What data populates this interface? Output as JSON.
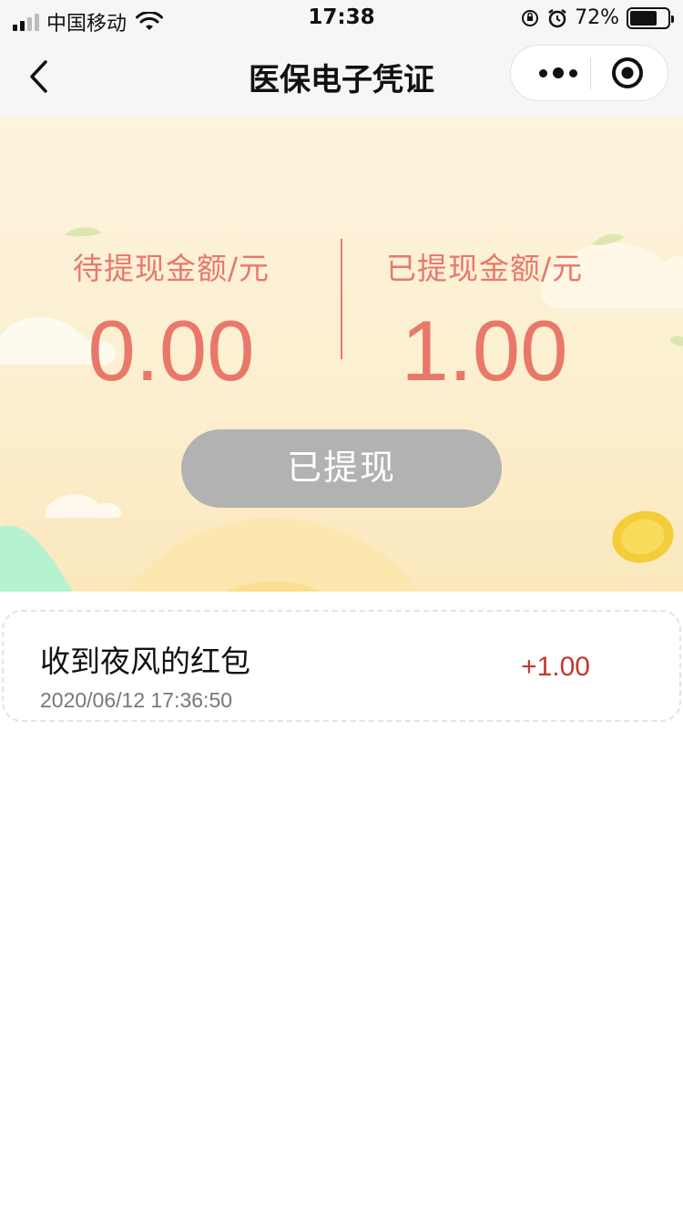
{
  "status_bar": {
    "carrier": "中国移动",
    "time": "17:38",
    "battery_percent": "72%",
    "battery_level": 0.72,
    "icons": [
      "signal-icon",
      "wifi-icon",
      "orientation-lock-icon",
      "alarm-icon",
      "battery-icon"
    ]
  },
  "nav": {
    "title": "医保电子凭证",
    "icons": [
      "back-chevron-icon",
      "more-dots-icon",
      "close-target-icon"
    ]
  },
  "summary": {
    "pending_label": "待提现金额/元",
    "pending_value": "0.00",
    "withdrawn_label": "已提现金额/元",
    "withdrawn_value": "1.00",
    "button_label": "已提现",
    "accent_color": "#e9786b",
    "button_color": "#b2b2b2"
  },
  "records": [
    {
      "title": "收到夜风的红包",
      "time": "2020/06/12 17:36:50",
      "amount": "+1.00",
      "amount_color": "#c0392b"
    }
  ]
}
